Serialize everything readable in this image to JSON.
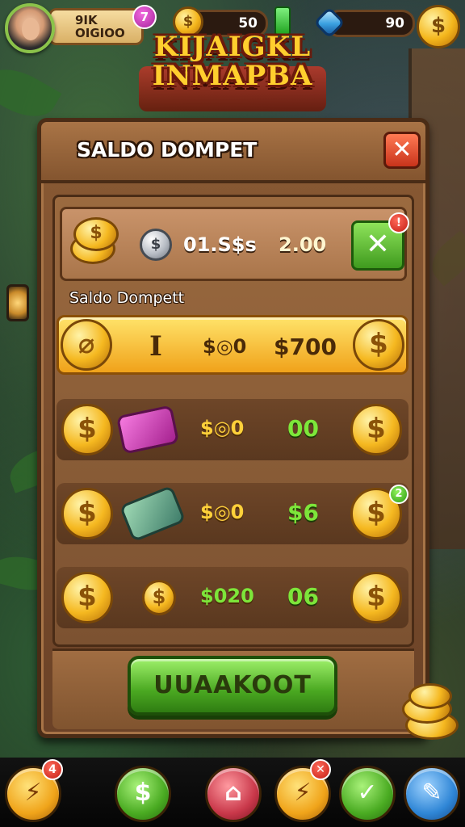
{
  "hud": {
    "player_name_line1": "9IK",
    "player_name_line2": "OIGIOO",
    "level": "7",
    "coins": "50",
    "gems": "90",
    "coin_icon_glyph": "$",
    "coin_button_glyph": "$",
    "icons": [
      "avatar",
      "coin-icon",
      "green-crystal-icon",
      "blue-gem-icon",
      "coin-shop-button"
    ]
  },
  "game_title": {
    "line1": "KIJAIGKL",
    "line2": "INMAPBA"
  },
  "panel": {
    "title": "SALDO DOMPET",
    "close_glyph": "✕",
    "summary": {
      "coin_glyph": "$",
      "silver_glyph": "$",
      "value1": "01.S$s",
      "value2": "2.00",
      "action_glyph": "✕",
      "badge": "!"
    },
    "section_label": "Saldo Dompett",
    "rows": [
      {
        "left_glyph": "⌀",
        "item_glyph": "I",
        "val1": "$◎0",
        "val2": "$700",
        "right_glyph": "$",
        "highlight": true
      },
      {
        "left_glyph": "$",
        "item_glyph": "wallet-pink",
        "val1": "$◎0",
        "val2": "00",
        "right_glyph": "$",
        "highlight": false
      },
      {
        "left_glyph": "$",
        "item_glyph": "cash-bundle",
        "val1": "$◎0",
        "val2": "$6",
        "right_glyph": "$",
        "badge": "2",
        "highlight": false
      },
      {
        "left_glyph": "$",
        "item_glyph": "$",
        "val1": "$020",
        "val2": "06",
        "right_glyph": "$",
        "highlight": false
      }
    ],
    "main_button": "UUAAKOOT"
  },
  "bottom_nav": [
    {
      "name": "lightning-icon",
      "glyph": "⚡",
      "style": "yellow",
      "badge": "4"
    },
    {
      "name": "dollar-icon",
      "glyph": "$",
      "style": "green"
    },
    {
      "name": "home-icon",
      "glyph": "⌂",
      "style": "red"
    },
    {
      "name": "bolt-icon",
      "glyph": "⚡",
      "style": "yellow",
      "badge": "✕"
    },
    {
      "name": "check-icon",
      "glyph": "✓",
      "style": "green"
    },
    {
      "name": "tools-icon",
      "glyph": "✎",
      "style": "blue"
    }
  ],
  "colors": {
    "panel_wood": "#8a5a34",
    "gold": "#f5b820",
    "green_button": "#4aa821",
    "red_close": "#c9331b"
  }
}
